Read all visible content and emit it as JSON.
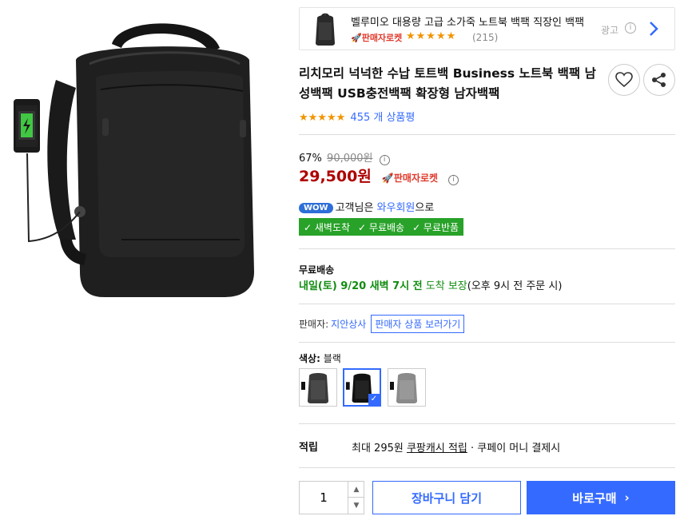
{
  "ad": {
    "title": "벨루미오 대용량 고급 소가죽 노트북 백팩 직장인 백팩",
    "rocket_label": "🚀판매자로켓",
    "stars": "★★★★★",
    "review_count": "(215)",
    "ad_label": "광고",
    "info_symbol": "i"
  },
  "product": {
    "title": "리치모리 넉넉한 수납 토트백 Business 노트북 백팩 남성백팩 USB충전백팩 확장형 남자백팩",
    "rating_stars": "★★★★★",
    "review_count": "455 개 상품평"
  },
  "price": {
    "discount_rate": "67%",
    "original_price": "90,000원",
    "sale_price": "29,500원",
    "rocket_label": "🚀판매자로켓",
    "info_symbol": "i"
  },
  "wow": {
    "badge": "WOW",
    "text_before": "고객님은 ",
    "link": "와우회원",
    "text_after": "으로"
  },
  "benefits": [
    "✓ 새벽도착",
    "✓ 무료배송",
    "✓ 무료반품"
  ],
  "shipping": {
    "label": "무료배송",
    "date": "내일(토) 9/20 새벽 7시 전",
    "guarantee": " 도착 보장",
    "note": "(오후 9시 전 주문 시)"
  },
  "seller": {
    "label": "판매자:",
    "name": "지안상사",
    "more_button": "판매자 상품 보러가기"
  },
  "color": {
    "label": "색상:",
    "selected": " 블랙",
    "options": [
      "다크그레이",
      "블랙",
      "그레이"
    ],
    "swatches": [
      "#3a3a3a",
      "#111111",
      "#8a8a8a"
    ]
  },
  "cash": {
    "label": "적립",
    "prefix": "최대 295원 ",
    "link": "쿠팡캐시 적립",
    "suffix": " · 쿠페이 머니 결제시"
  },
  "purchase": {
    "quantity": "1",
    "up_symbol": "▲",
    "down_symbol": "▼",
    "cart_label": "장바구니 담기",
    "buy_label": "바로구매",
    "buy_chevron": "›"
  },
  "colors": {
    "accent": "#346aff",
    "sale_red": "#ae0000",
    "star_orange": "#f29400",
    "rocket_red": "#e03a2d",
    "benefit_green": "#28a229",
    "ship_green": "#118c0f"
  }
}
